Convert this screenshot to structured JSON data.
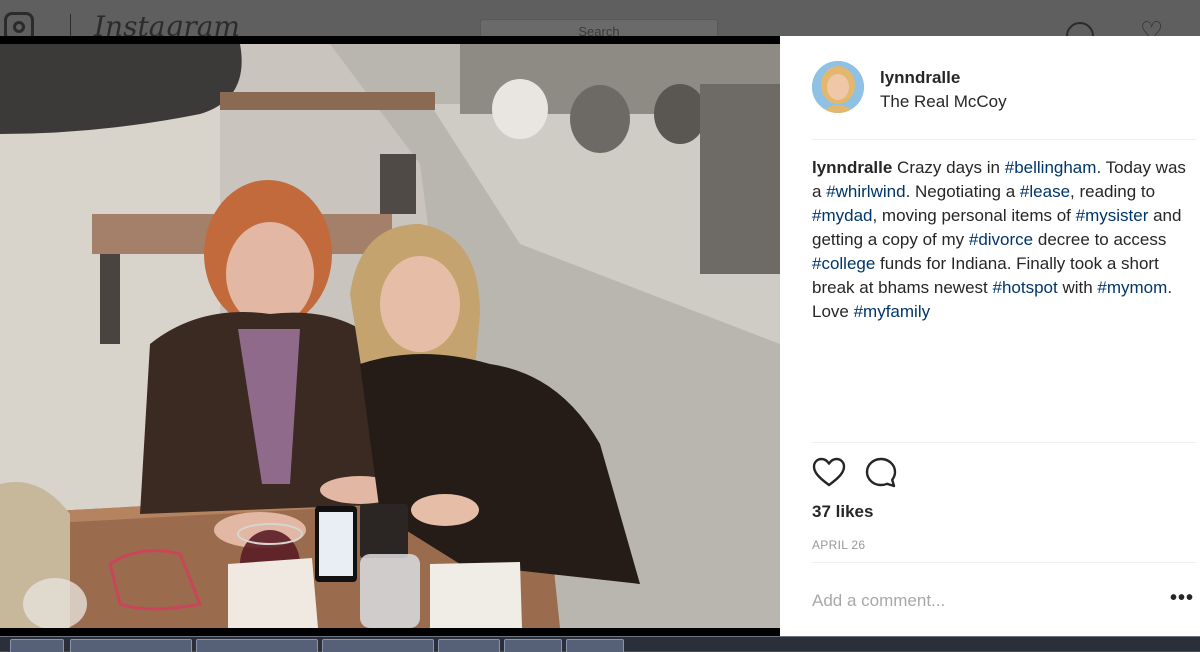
{
  "background": {
    "brand": "Instagram",
    "search_placeholder": "Search",
    "icons": [
      "instagram-camera-icon",
      "explore-compass-icon",
      "activity-heart-icon"
    ]
  },
  "post": {
    "username": "lynndralle",
    "location": "The Real McCoy",
    "caption": [
      {
        "text": "lynndralle",
        "type": "user"
      },
      {
        "text": " Crazy days in ",
        "type": "text"
      },
      {
        "text": "#bellingham",
        "type": "tag"
      },
      {
        "text": ". Today was a ",
        "type": "text"
      },
      {
        "text": "#whirlwind",
        "type": "tag"
      },
      {
        "text": ". Negotiating a ",
        "type": "text"
      },
      {
        "text": "#lease",
        "type": "tag"
      },
      {
        "text": ", reading to ",
        "type": "text"
      },
      {
        "text": "#mydad",
        "type": "tag"
      },
      {
        "text": ", moving personal items of ",
        "type": "text"
      },
      {
        "text": "#mysister",
        "type": "tag"
      },
      {
        "text": " and getting a copy of my ",
        "type": "text"
      },
      {
        "text": "#divorce",
        "type": "tag"
      },
      {
        "text": " decree to access ",
        "type": "text"
      },
      {
        "text": "#college",
        "type": "tag"
      },
      {
        "text": " funds for Indiana. Finally took a short break at bhams newest ",
        "type": "text"
      },
      {
        "text": "#hotspot",
        "type": "tag"
      },
      {
        "text": " with ",
        "type": "text"
      },
      {
        "text": "#mymom",
        "type": "tag"
      },
      {
        "text": ". Love ",
        "type": "text"
      },
      {
        "text": "#myfamily",
        "type": "tag"
      }
    ],
    "likes": "37 likes",
    "date": "APRIL 26",
    "comment_placeholder": "Add a comment...",
    "more_label": "•••"
  },
  "colors": {
    "hashtag": "#003569",
    "text": "#262626",
    "muted": "#999999"
  }
}
